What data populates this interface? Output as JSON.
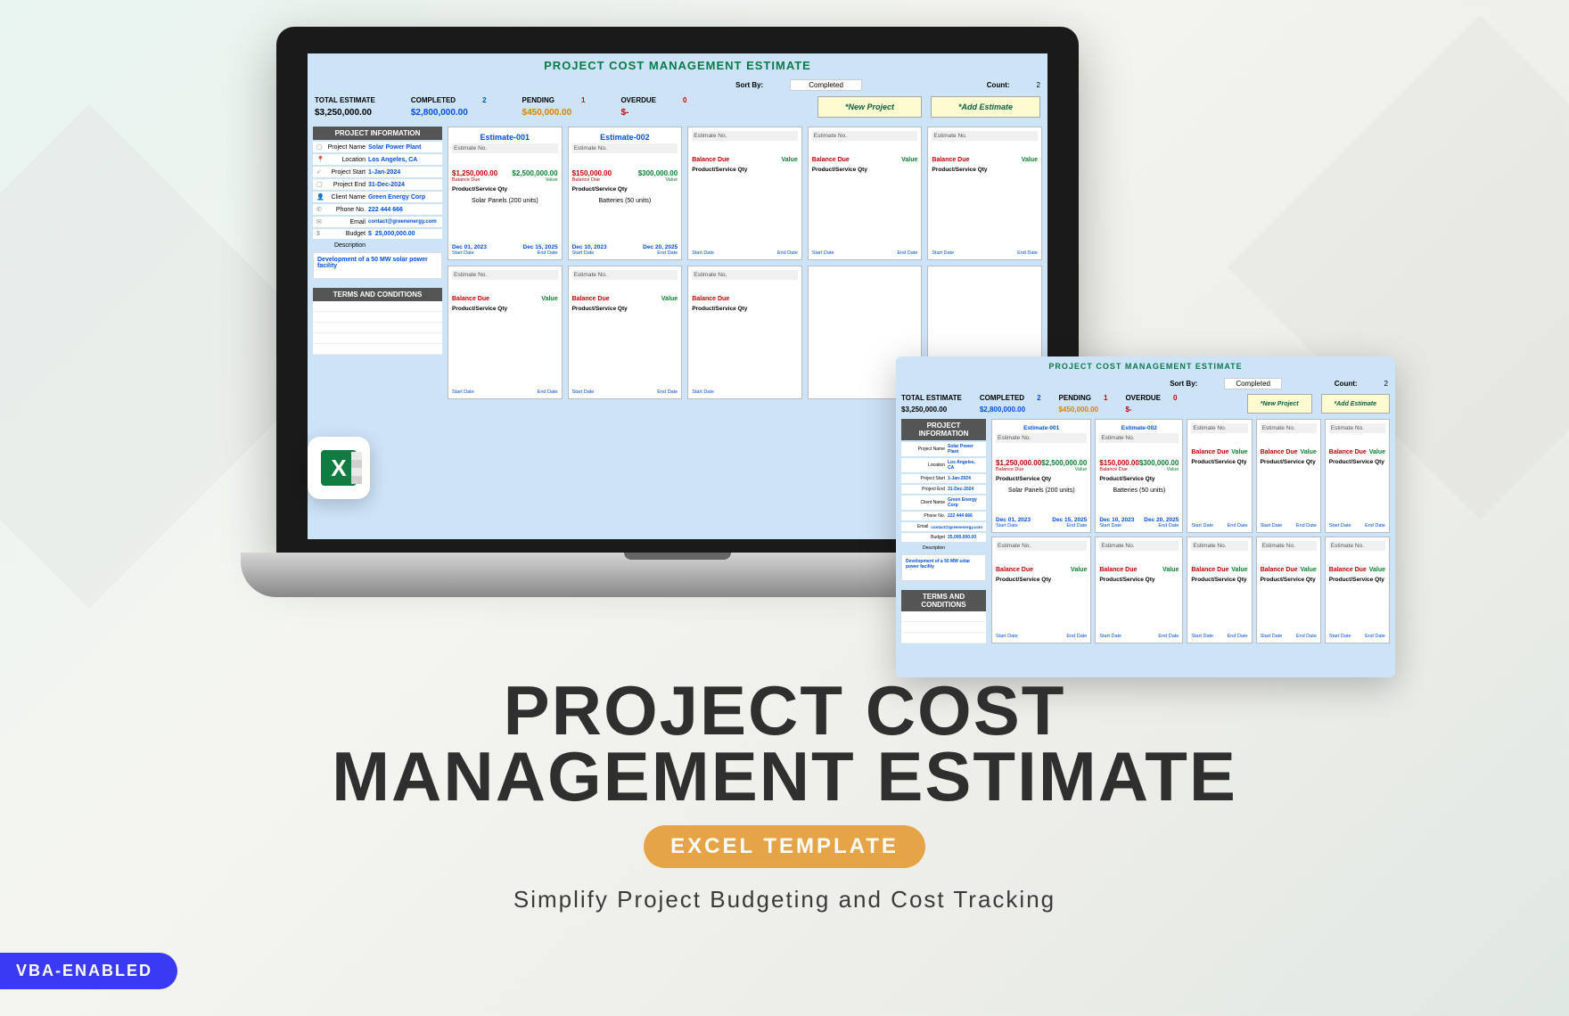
{
  "hero": {
    "title_l1": "PROJECT COST",
    "title_l2": "MANAGEMENT ESTIMATE",
    "pill": "EXCEL TEMPLATE",
    "tagline": "Simplify Project Budgeting and Cost Tracking"
  },
  "vba_badge": "VBA-ENABLED",
  "excel_glyph": "X",
  "sheet": {
    "title": "PROJECT COST MANAGEMENT ESTIMATE",
    "sort_by_label": "Sort By:",
    "sort_by_value": "Completed",
    "count_label": "Count:",
    "count_value": "2",
    "stats": {
      "total_label": "TOTAL ESTIMATE",
      "total_value": "$3,250,000.00",
      "completed_label": "COMPLETED",
      "completed_count": "2",
      "completed_value": "$2,800,000.00",
      "pending_label": "PENDING",
      "pending_count": "1",
      "pending_value": "$450,000.00",
      "overdue_label": "OVERDUE",
      "overdue_count": "0",
      "overdue_value": "$-"
    },
    "buttons": {
      "new_project": "*New Project",
      "add_estimate": "*Add Estimate"
    },
    "project_info_header": "PROJECT INFORMATION",
    "terms_header": "TERMS AND CONDITIONS",
    "info": {
      "project_name_k": "Project Name",
      "project_name_v": "Solar Power Plant",
      "location_k": "Location",
      "location_v": "Los Angeles, CA",
      "start_k": "Project Start",
      "start_v": "1-Jan-2024",
      "end_k": "Project End",
      "end_v": "31-Dec-2024",
      "client_k": "Client Name",
      "client_v": "Green Energy Corp",
      "phone_k": "Phone No.",
      "phone_v": "222 444 666",
      "email_k": "Email",
      "email_v": "contact@greenenergy.com",
      "budget_k": "Budget",
      "budget_cur": "$",
      "budget_v": "25,000,000.00",
      "desc_k": "Description",
      "desc_v": "Development of a 50 MW solar power facility"
    },
    "card_labels": {
      "est_no": "Estimate No.",
      "balance_due": "Balance Due",
      "value": "Value",
      "psq": "Product/Service Qty",
      "start_date": "Start Date",
      "end_date": "End Date"
    },
    "cards": [
      {
        "id": "Estimate-001",
        "balance": "$1,250,000.00",
        "value": "$2,500,000.00",
        "item": "Solar Panels (200 units)",
        "start": "Dec 01, 2023",
        "end": "Dec 15, 2025"
      },
      {
        "id": "Estimate-002",
        "balance": "$150,000.00",
        "value": "$300,000.00",
        "item": "Batteries (50 units)",
        "start": "Dec 10, 2023",
        "end": "Dec 20, 2025"
      }
    ]
  }
}
